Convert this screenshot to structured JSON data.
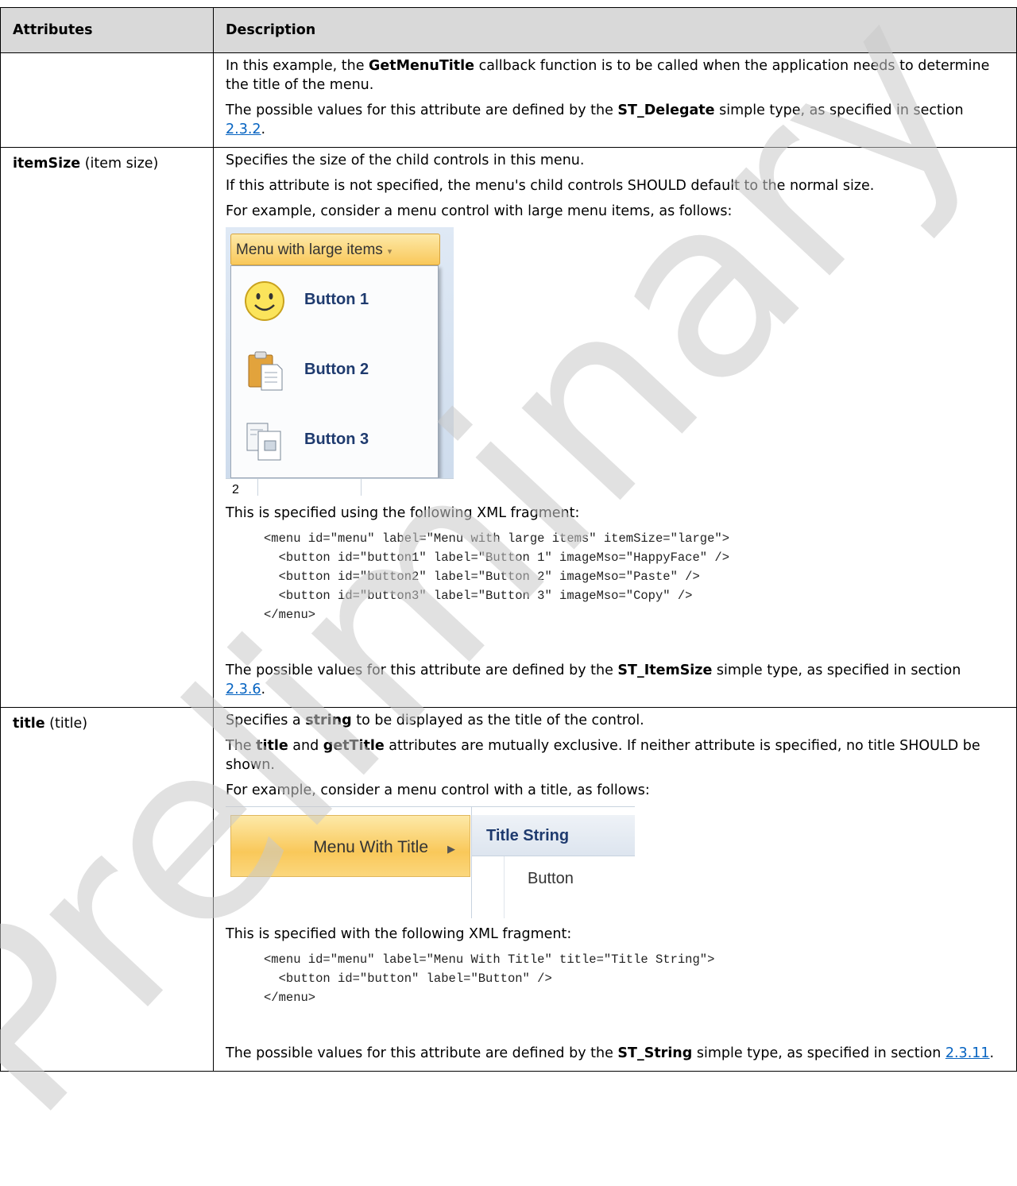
{
  "table": {
    "header": {
      "col1": "Attributes",
      "col2": "Description"
    },
    "row0": {
      "p1_a": "In this example, the ",
      "p1_b": "GetMenuTitle",
      "p1_c": " callback function is to be called when the application needs to determine the title of the menu.",
      "p2_a": "The possible values for this attribute are defined by the ",
      "p2_b": "ST_Delegate",
      "p2_c": " simple type, as specified in section ",
      "p2_link": "2.3.2",
      "p2_end": "."
    },
    "row1": {
      "attr_name": "itemSize",
      "attr_desc": " (item size)",
      "p1": "Specifies the size of the child controls in this menu.",
      "p2": "If this attribute is not specified, the menu's child controls SHOULD default to the normal size.",
      "p3": "For example, consider a menu control with large menu items, as follows:",
      "shot": {
        "menu_label": "Menu with large items",
        "arrow": "▾",
        "buttons": [
          "Button 1",
          "Button 2",
          "Button 3"
        ],
        "bottom_text": "2"
      },
      "p4": "This is specified using the following XML fragment:",
      "code": "<menu id=\"menu\" label=\"Menu with large items\" itemSize=\"large\">\n  <button id=\"button1\" label=\"Button 1\" imageMso=\"HappyFace\" />\n  <button id=\"button2\" label=\"Button 2\" imageMso=\"Paste\" />\n  <button id=\"button3\" label=\"Button 3\" imageMso=\"Copy\" />\n</menu>",
      "p5_a": "The possible values for this attribute are defined by the ",
      "p5_b": "ST_ItemSize",
      "p5_c": " simple type, as specified in section ",
      "p5_link": "2.3.6",
      "p5_end": "."
    },
    "row2": {
      "attr_name": "title",
      "attr_desc": " (title)",
      "p1_a": "Specifies a ",
      "p1_b": "string",
      "p1_c": " to be displayed as the title of the control.",
      "p2_a": "The ",
      "p2_b": "title",
      "p2_c": " and ",
      "p2_d": "getTitle",
      "p2_e": " attributes are mutually exclusive. If neither attribute is specified, no title SHOULD be shown.",
      "p3": "For example, consider a menu control with a title, as follows:",
      "shot": {
        "menu_label": "Menu With Title",
        "arrow": "▶",
        "title": "Title String",
        "button": "Button"
      },
      "p4": "This is specified with the following XML fragment:",
      "code": "<menu id=\"menu\" label=\"Menu With Title\" title=\"Title String\">\n  <button id=\"button\" label=\"Button\" />\n</menu>",
      "p5_a": "The possible values for this attribute are defined by the ",
      "p5_b": "ST_String",
      "p5_c": " simple type, as specified in section ",
      "p5_link": "2.3.11",
      "p5_end": "."
    }
  },
  "watermark": {
    "text": "Preliminary",
    "color": "#c8c8c8"
  }
}
